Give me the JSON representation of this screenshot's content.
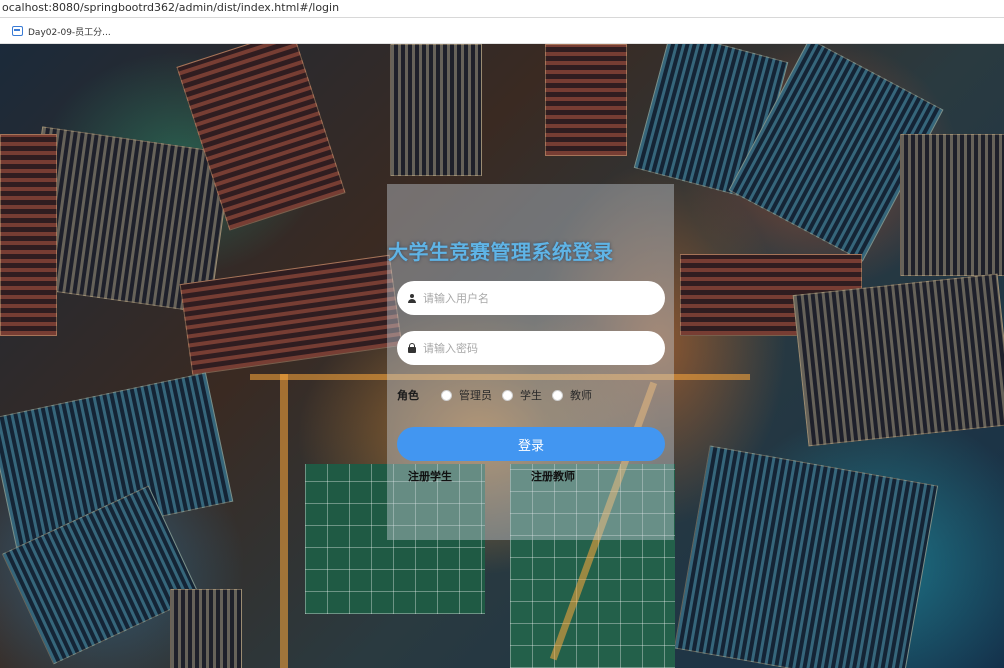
{
  "browser": {
    "url": "ocalhost:8080/springbootrd362/admin/dist/index.html#/login",
    "bookmark_label": "Day02-09-员工分..."
  },
  "login": {
    "title": "大学生竞赛管理系统登录",
    "username_placeholder": "请输入用户名",
    "password_placeholder": "请输入密码",
    "role_label": "角色",
    "roles": [
      "管理员",
      "学生",
      "教师"
    ],
    "login_button": "登录",
    "register_student": "注册学生",
    "register_teacher": "注册教师"
  },
  "colors": {
    "title": "#5fb4e6",
    "button": "#4296f1"
  }
}
